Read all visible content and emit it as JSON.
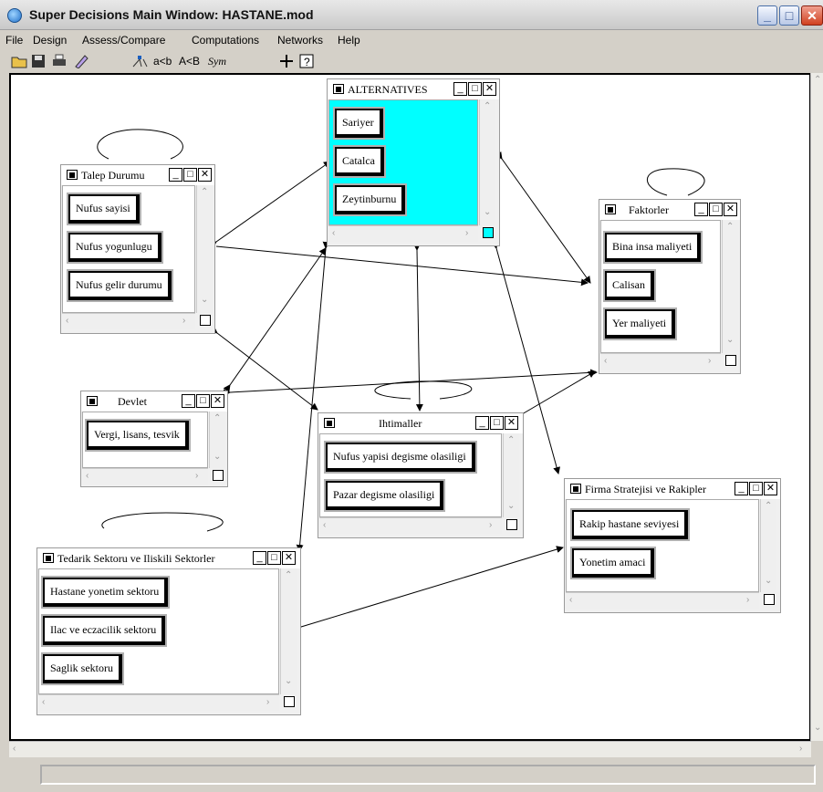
{
  "window": {
    "title": "Super Decisions Main Window: HASTANE.mod",
    "min_glyph": "_",
    "max_glyph": "□",
    "close_glyph": "✕"
  },
  "menu": [
    "File",
    "Design",
    "Assess/Compare",
    "Computations",
    "Networks",
    "Help"
  ],
  "toolbar": {
    "compare_label": "a<b",
    "compare_upper_label": "A<B",
    "sym_label": "Sym"
  },
  "panel_controls": {
    "min": "_",
    "max": "□",
    "close": "✕"
  },
  "scroll_glyphs": {
    "up": "⌃",
    "down": "⌄",
    "left": "‹",
    "right": "›"
  },
  "clusters": {
    "alternatives": {
      "title": "ALTERNATIVES",
      "nodes": [
        "Sariyer",
        "Catalca",
        "Zeytinburnu"
      ]
    },
    "talep": {
      "title": "Talep Durumu",
      "nodes": [
        "Nufus sayisi",
        "Nufus yogunlugu",
        "Nufus gelir durumu"
      ]
    },
    "faktorler": {
      "title": "Faktorler",
      "nodes": [
        "Bina insa maliyeti",
        "Calisan",
        "Yer maliyeti"
      ]
    },
    "devlet": {
      "title": "Devlet",
      "nodes": [
        "Vergi, lisans, tesvik"
      ]
    },
    "ihtimaller": {
      "title": "Ihtimaller",
      "nodes": [
        "Nufus yapisi degisme olasiligi",
        "Pazar degisme olasiligi"
      ]
    },
    "firma": {
      "title": "Firma Stratejisi ve Rakipler",
      "nodes": [
        "Rakip hastane seviyesi",
        "Yonetim amaci"
      ]
    },
    "tedarik": {
      "title": "Tedarik Sektoru ve Iliskili Sektorler",
      "nodes": [
        "Hastane yonetim sektoru",
        "Ilac ve eczacilik sektoru",
        "Saglik sektoru"
      ]
    }
  },
  "colors": {
    "alternatives_fill": "#00ffff",
    "canvas": "#ffffff",
    "chrome": "#d4d0c8"
  }
}
